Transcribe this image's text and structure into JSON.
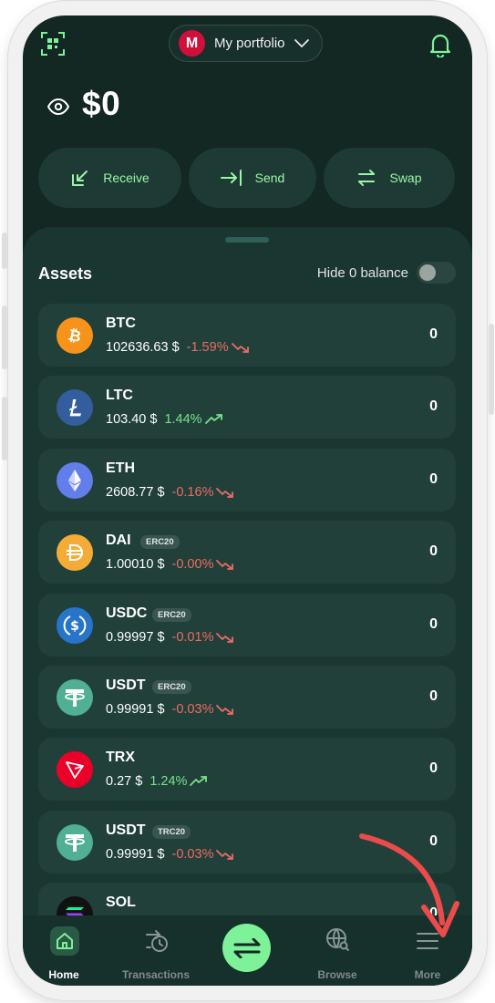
{
  "header": {
    "portfolio_initial": "M",
    "portfolio_name": "My portfolio"
  },
  "balance": {
    "amount": "$0"
  },
  "actions": [
    {
      "label": "Receive",
      "icon": "receive-icon"
    },
    {
      "label": "Send",
      "icon": "send-icon"
    },
    {
      "label": "Swap",
      "icon": "swap-icon"
    }
  ],
  "assets": {
    "title": "Assets",
    "hide_zero_label": "Hide 0 balance",
    "hide_zero_enabled": false,
    "items": [
      {
        "symbol": "BTC",
        "network": "",
        "price": "102636.63 $",
        "change": "-1.59%",
        "trend": "down",
        "balance": "0",
        "color": "#f7931a"
      },
      {
        "symbol": "LTC",
        "network": "",
        "price": "103.40 $",
        "change": "1.44%",
        "trend": "up",
        "balance": "0",
        "color": "#345d9d"
      },
      {
        "symbol": "ETH",
        "network": "",
        "price": "2608.77 $",
        "change": "-0.16%",
        "trend": "down",
        "balance": "0",
        "color": "#627eea"
      },
      {
        "symbol": "DAI",
        "network": "ERC20",
        "price": "1.00010 $",
        "change": "-0.00%",
        "trend": "down",
        "balance": "0",
        "color": "#f5ac37"
      },
      {
        "symbol": "USDC",
        "network": "ERC20",
        "price": "0.99997 $",
        "change": "-0.01%",
        "trend": "down",
        "balance": "0",
        "color": "#2775ca"
      },
      {
        "symbol": "USDT",
        "network": "ERC20",
        "price": "0.99991 $",
        "change": "-0.03%",
        "trend": "down",
        "balance": "0",
        "color": "#50af95"
      },
      {
        "symbol": "TRX",
        "network": "",
        "price": "0.27 $",
        "change": "1.24%",
        "trend": "up",
        "balance": "0",
        "color": "#eb0029"
      },
      {
        "symbol": "USDT",
        "network": "TRC20",
        "price": "0.99991 $",
        "change": "-0.03%",
        "trend": "down",
        "balance": "0",
        "color": "#50af95"
      },
      {
        "symbol": "SOL",
        "network": "",
        "price": "",
        "change": "",
        "trend": "",
        "balance": "0",
        "color": "#111111"
      }
    ]
  },
  "nav": [
    {
      "label": "Home",
      "active": true
    },
    {
      "label": "Transactions",
      "active": false
    },
    {
      "label": "",
      "active": false
    },
    {
      "label": "Browse",
      "active": false
    },
    {
      "label": "More",
      "active": false
    }
  ],
  "colors": {
    "accent": "#7ef299",
    "negative": "#ef6a64",
    "positive": "#77e38b",
    "annotation": "#ec4b4b"
  }
}
